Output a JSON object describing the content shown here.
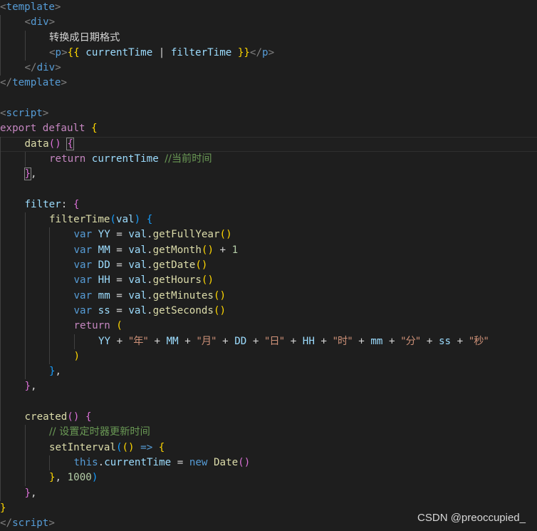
{
  "colors": {
    "background": "#1e1e1e",
    "tag": "#569cd6",
    "bracket": "#808080",
    "keyword": "#c586c0",
    "function": "#dcdcaa",
    "variable": "#9cdcfe",
    "string": "#ce9178",
    "number": "#b5cea8",
    "comment": "#6a9955",
    "text": "#d4d4d4",
    "brace_gold": "#ffd700",
    "brace_purple": "#da70d6",
    "brace_blue": "#179fff"
  },
  "watermark": "CSDN @preoccupied_",
  "lines": [
    {
      "indent": 0,
      "tokens": [
        {
          "t": "<",
          "c": "#808080"
        },
        {
          "t": "template",
          "c": "#569cd6"
        },
        {
          "t": ">",
          "c": "#808080"
        }
      ]
    },
    {
      "indent": 1,
      "tokens": [
        {
          "t": "<",
          "c": "#808080"
        },
        {
          "t": "div",
          "c": "#569cd6"
        },
        {
          "t": ">",
          "c": "#808080"
        }
      ]
    },
    {
      "indent": 2,
      "tokens": [
        {
          "t": "转换成日期格式",
          "c": "#d4d4d4",
          "cjk": true
        }
      ]
    },
    {
      "indent": 2,
      "tokens": [
        {
          "t": "<",
          "c": "#808080"
        },
        {
          "t": "p",
          "c": "#569cd6"
        },
        {
          "t": ">",
          "c": "#808080"
        },
        {
          "t": "{{",
          "c": "#ffd700"
        },
        {
          "t": " currentTime ",
          "c": "#9cdcfe"
        },
        {
          "t": "|",
          "c": "#d4d4d4"
        },
        {
          "t": " filterTime ",
          "c": "#9cdcfe"
        },
        {
          "t": "}}",
          "c": "#ffd700"
        },
        {
          "t": "</",
          "c": "#808080"
        },
        {
          "t": "p",
          "c": "#569cd6"
        },
        {
          "t": ">",
          "c": "#808080"
        }
      ]
    },
    {
      "indent": 1,
      "tokens": [
        {
          "t": "</",
          "c": "#808080"
        },
        {
          "t": "div",
          "c": "#569cd6"
        },
        {
          "t": ">",
          "c": "#808080"
        }
      ]
    },
    {
      "indent": 0,
      "tokens": [
        {
          "t": "</",
          "c": "#808080"
        },
        {
          "t": "template",
          "c": "#569cd6"
        },
        {
          "t": ">",
          "c": "#808080"
        }
      ]
    },
    {
      "indent": 0,
      "tokens": []
    },
    {
      "indent": 0,
      "tokens": [
        {
          "t": "<",
          "c": "#808080"
        },
        {
          "t": "script",
          "c": "#569cd6"
        },
        {
          "t": ">",
          "c": "#808080"
        }
      ]
    },
    {
      "indent": 0,
      "tokens": [
        {
          "t": "export",
          "c": "#c586c0"
        },
        {
          "t": " ",
          "c": "#d4d4d4"
        },
        {
          "t": "default",
          "c": "#c586c0"
        },
        {
          "t": " ",
          "c": "#d4d4d4"
        },
        {
          "t": "{",
          "c": "#ffd700"
        }
      ]
    },
    {
      "indent": 1,
      "current": true,
      "tokens": [
        {
          "t": "data",
          "c": "#dcdcaa"
        },
        {
          "t": "()",
          "c": "#da70d6"
        },
        {
          "t": " ",
          "c": "#d4d4d4"
        },
        {
          "t": "{",
          "c": "#da70d6",
          "cursor": true
        }
      ]
    },
    {
      "indent": 2,
      "tokens": [
        {
          "t": "return",
          "c": "#c586c0"
        },
        {
          "t": " currentTime ",
          "c": "#9cdcfe"
        },
        {
          "t": "//当前时间",
          "c": "#6a9955",
          "cjk": true
        }
      ]
    },
    {
      "indent": 1,
      "tokens": [
        {
          "t": "}",
          "c": "#da70d6",
          "cursor": true
        },
        {
          "t": ",",
          "c": "#d4d4d4"
        }
      ]
    },
    {
      "indent": 0,
      "tokens": []
    },
    {
      "indent": 1,
      "tokens": [
        {
          "t": "filter",
          "c": "#9cdcfe"
        },
        {
          "t": ": ",
          "c": "#d4d4d4"
        },
        {
          "t": "{",
          "c": "#da70d6"
        }
      ]
    },
    {
      "indent": 2,
      "tokens": [
        {
          "t": "filterTime",
          "c": "#dcdcaa"
        },
        {
          "t": "(",
          "c": "#179fff"
        },
        {
          "t": "val",
          "c": "#9cdcfe"
        },
        {
          "t": ")",
          "c": "#179fff"
        },
        {
          "t": " ",
          "c": "#d4d4d4"
        },
        {
          "t": "{",
          "c": "#179fff"
        }
      ]
    },
    {
      "indent": 3,
      "tokens": [
        {
          "t": "var",
          "c": "#569cd6"
        },
        {
          "t": " YY ",
          "c": "#9cdcfe"
        },
        {
          "t": "= ",
          "c": "#d4d4d4"
        },
        {
          "t": "val",
          "c": "#9cdcfe"
        },
        {
          "t": ".",
          "c": "#d4d4d4"
        },
        {
          "t": "getFullYear",
          "c": "#dcdcaa"
        },
        {
          "t": "()",
          "c": "#ffd700"
        }
      ]
    },
    {
      "indent": 3,
      "tokens": [
        {
          "t": "var",
          "c": "#569cd6"
        },
        {
          "t": " MM ",
          "c": "#9cdcfe"
        },
        {
          "t": "= ",
          "c": "#d4d4d4"
        },
        {
          "t": "val",
          "c": "#9cdcfe"
        },
        {
          "t": ".",
          "c": "#d4d4d4"
        },
        {
          "t": "getMonth",
          "c": "#dcdcaa"
        },
        {
          "t": "()",
          "c": "#ffd700"
        },
        {
          "t": " + ",
          "c": "#d4d4d4"
        },
        {
          "t": "1",
          "c": "#b5cea8"
        }
      ]
    },
    {
      "indent": 3,
      "tokens": [
        {
          "t": "var",
          "c": "#569cd6"
        },
        {
          "t": " DD ",
          "c": "#9cdcfe"
        },
        {
          "t": "= ",
          "c": "#d4d4d4"
        },
        {
          "t": "val",
          "c": "#9cdcfe"
        },
        {
          "t": ".",
          "c": "#d4d4d4"
        },
        {
          "t": "getDate",
          "c": "#dcdcaa"
        },
        {
          "t": "()",
          "c": "#ffd700"
        }
      ]
    },
    {
      "indent": 3,
      "tokens": [
        {
          "t": "var",
          "c": "#569cd6"
        },
        {
          "t": " HH ",
          "c": "#9cdcfe"
        },
        {
          "t": "= ",
          "c": "#d4d4d4"
        },
        {
          "t": "val",
          "c": "#9cdcfe"
        },
        {
          "t": ".",
          "c": "#d4d4d4"
        },
        {
          "t": "getHours",
          "c": "#dcdcaa"
        },
        {
          "t": "()",
          "c": "#ffd700"
        }
      ]
    },
    {
      "indent": 3,
      "tokens": [
        {
          "t": "var",
          "c": "#569cd6"
        },
        {
          "t": " mm ",
          "c": "#9cdcfe"
        },
        {
          "t": "= ",
          "c": "#d4d4d4"
        },
        {
          "t": "val",
          "c": "#9cdcfe"
        },
        {
          "t": ".",
          "c": "#d4d4d4"
        },
        {
          "t": "getMinutes",
          "c": "#dcdcaa"
        },
        {
          "t": "()",
          "c": "#ffd700"
        }
      ]
    },
    {
      "indent": 3,
      "tokens": [
        {
          "t": "var",
          "c": "#569cd6"
        },
        {
          "t": " ss ",
          "c": "#9cdcfe"
        },
        {
          "t": "= ",
          "c": "#d4d4d4"
        },
        {
          "t": "val",
          "c": "#9cdcfe"
        },
        {
          "t": ".",
          "c": "#d4d4d4"
        },
        {
          "t": "getSeconds",
          "c": "#dcdcaa"
        },
        {
          "t": "()",
          "c": "#ffd700"
        }
      ]
    },
    {
      "indent": 3,
      "tokens": [
        {
          "t": "return",
          "c": "#c586c0"
        },
        {
          "t": " ",
          "c": "#d4d4d4"
        },
        {
          "t": "(",
          "c": "#ffd700"
        }
      ]
    },
    {
      "indent": 4,
      "tokens": [
        {
          "t": "YY",
          "c": "#9cdcfe"
        },
        {
          "t": " + ",
          "c": "#d4d4d4"
        },
        {
          "t": "\"年\"",
          "c": "#ce9178",
          "cjk": true
        },
        {
          "t": " + ",
          "c": "#d4d4d4"
        },
        {
          "t": "MM",
          "c": "#9cdcfe"
        },
        {
          "t": " + ",
          "c": "#d4d4d4"
        },
        {
          "t": "\"月\"",
          "c": "#ce9178",
          "cjk": true
        },
        {
          "t": " + ",
          "c": "#d4d4d4"
        },
        {
          "t": "DD",
          "c": "#9cdcfe"
        },
        {
          "t": " + ",
          "c": "#d4d4d4"
        },
        {
          "t": "\"日\"",
          "c": "#ce9178",
          "cjk": true
        },
        {
          "t": " + ",
          "c": "#d4d4d4"
        },
        {
          "t": "HH",
          "c": "#9cdcfe"
        },
        {
          "t": " + ",
          "c": "#d4d4d4"
        },
        {
          "t": "\"时\"",
          "c": "#ce9178",
          "cjk": true
        },
        {
          "t": " + ",
          "c": "#d4d4d4"
        },
        {
          "t": "mm",
          "c": "#9cdcfe"
        },
        {
          "t": " + ",
          "c": "#d4d4d4"
        },
        {
          "t": "\"分\"",
          "c": "#ce9178",
          "cjk": true
        },
        {
          "t": " + ",
          "c": "#d4d4d4"
        },
        {
          "t": "ss",
          "c": "#9cdcfe"
        },
        {
          "t": " + ",
          "c": "#d4d4d4"
        },
        {
          "t": "\"秒\"",
          "c": "#ce9178",
          "cjk": true
        }
      ]
    },
    {
      "indent": 3,
      "tokens": [
        {
          "t": ")",
          "c": "#ffd700"
        }
      ]
    },
    {
      "indent": 2,
      "tokens": [
        {
          "t": "}",
          "c": "#179fff"
        },
        {
          "t": ",",
          "c": "#d4d4d4"
        }
      ]
    },
    {
      "indent": 1,
      "tokens": [
        {
          "t": "}",
          "c": "#da70d6"
        },
        {
          "t": ",",
          "c": "#d4d4d4"
        }
      ]
    },
    {
      "indent": 0,
      "tokens": []
    },
    {
      "indent": 1,
      "tokens": [
        {
          "t": "created",
          "c": "#dcdcaa"
        },
        {
          "t": "()",
          "c": "#da70d6"
        },
        {
          "t": " ",
          "c": "#d4d4d4"
        },
        {
          "t": "{",
          "c": "#da70d6"
        }
      ]
    },
    {
      "indent": 2,
      "tokens": [
        {
          "t": "// 设置定时器更新时间",
          "c": "#6a9955",
          "cjk": true
        }
      ]
    },
    {
      "indent": 2,
      "tokens": [
        {
          "t": "setInterval",
          "c": "#dcdcaa"
        },
        {
          "t": "(",
          "c": "#179fff"
        },
        {
          "t": "()",
          "c": "#ffd700"
        },
        {
          "t": " ",
          "c": "#d4d4d4"
        },
        {
          "t": "=>",
          "c": "#569cd6"
        },
        {
          "t": " ",
          "c": "#d4d4d4"
        },
        {
          "t": "{",
          "c": "#ffd700"
        }
      ]
    },
    {
      "indent": 3,
      "tokens": [
        {
          "t": "this",
          "c": "#569cd6"
        },
        {
          "t": ".",
          "c": "#d4d4d4"
        },
        {
          "t": "currentTime",
          "c": "#9cdcfe"
        },
        {
          "t": " = ",
          "c": "#d4d4d4"
        },
        {
          "t": "new",
          "c": "#569cd6"
        },
        {
          "t": " ",
          "c": "#d4d4d4"
        },
        {
          "t": "Date",
          "c": "#dcdcaa"
        },
        {
          "t": "()",
          "c": "#da70d6"
        }
      ]
    },
    {
      "indent": 2,
      "tokens": [
        {
          "t": "}",
          "c": "#ffd700"
        },
        {
          "t": ", ",
          "c": "#d4d4d4"
        },
        {
          "t": "1000",
          "c": "#b5cea8"
        },
        {
          "t": ")",
          "c": "#179fff"
        }
      ]
    },
    {
      "indent": 1,
      "tokens": [
        {
          "t": "}",
          "c": "#da70d6"
        },
        {
          "t": ",",
          "c": "#d4d4d4"
        }
      ]
    },
    {
      "indent": 0,
      "tokens": [
        {
          "t": "}",
          "c": "#ffd700"
        }
      ]
    },
    {
      "indent": 0,
      "tokens": [
        {
          "t": "</",
          "c": "#808080"
        },
        {
          "t": "script",
          "c": "#569cd6"
        },
        {
          "t": ">",
          "c": "#808080"
        }
      ]
    }
  ]
}
